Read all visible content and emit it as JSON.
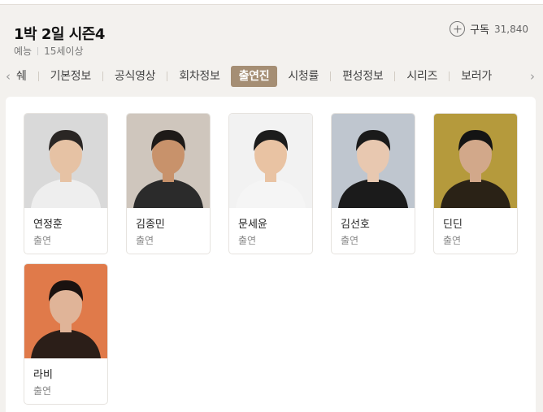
{
  "header": {
    "title": "1박 2일 시즌4",
    "genre": "예능",
    "rating": "15세이상",
    "subscribe_label": "구독",
    "subscriber_count": "31,840"
  },
  "tabs": [
    {
      "label": "쉐"
    },
    {
      "label": "기본정보"
    },
    {
      "label": "공식영상"
    },
    {
      "label": "회차정보"
    },
    {
      "label": "출연진",
      "active": true
    },
    {
      "label": "시청률"
    },
    {
      "label": "편성정보"
    },
    {
      "label": "시리즈"
    },
    {
      "label": "보러가"
    }
  ],
  "cast": [
    {
      "name": "연정훈",
      "role": "출연",
      "bg": "#d9d9d9",
      "skin": "#e6c2a4",
      "hair": "#2a2624",
      "shirt": "#eeeeee"
    },
    {
      "name": "김종민",
      "role": "출연",
      "bg": "#cfc6bd",
      "skin": "#c8926b",
      "hair": "#1e1a18",
      "shirt": "#2b2b2b"
    },
    {
      "name": "문세윤",
      "role": "출연",
      "bg": "#f2f2f2",
      "skin": "#e9c3a3",
      "hair": "#1c1c1c",
      "shirt": "#f5f5f5"
    },
    {
      "name": "김선호",
      "role": "출연",
      "bg": "#bfc6cf",
      "skin": "#e8c8b0",
      "hair": "#1a1a1a",
      "shirt": "#1b1b1b"
    },
    {
      "name": "딘딘",
      "role": "출연",
      "bg": "#b59a3c",
      "skin": "#d2a88a",
      "hair": "#141414",
      "shirt": "#2a2216"
    },
    {
      "name": "라비",
      "role": "출연",
      "bg": "#e07a4a",
      "skin": "#e0b498",
      "hair": "#1a1210",
      "shirt": "#2b1e18"
    }
  ]
}
